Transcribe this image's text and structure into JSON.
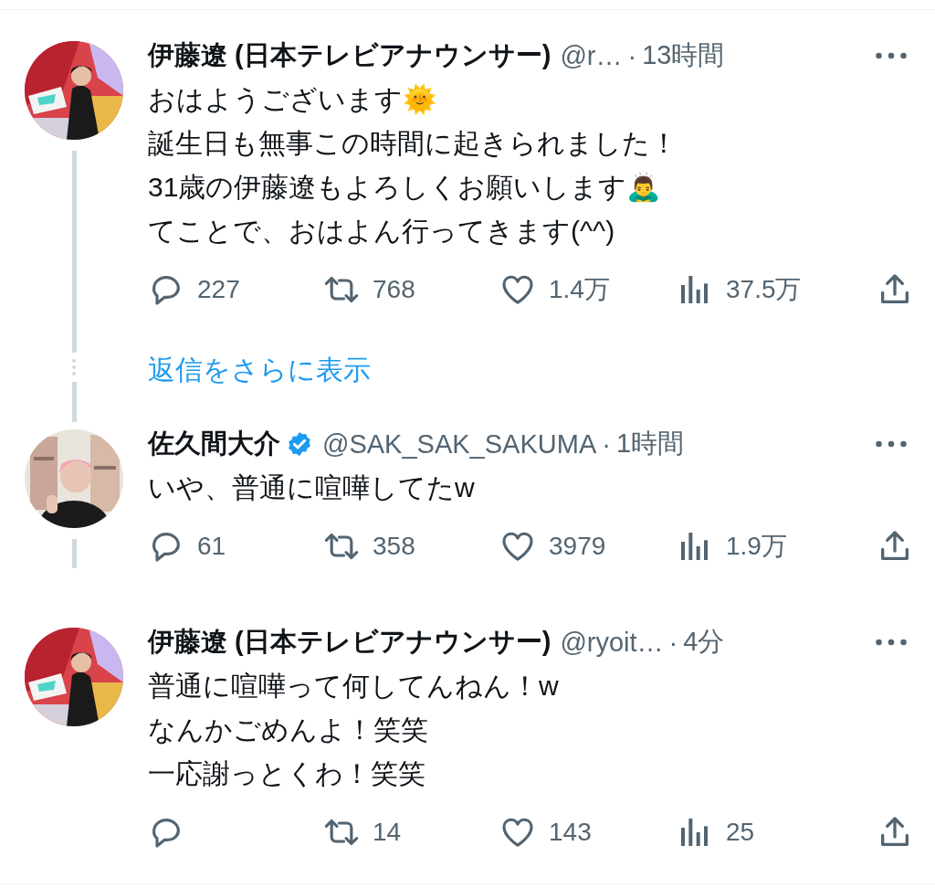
{
  "thread": [
    {
      "author_name": "伊藤遼 (日本テレビアナウンサー)",
      "verified": false,
      "handle": "@r…",
      "separator": "·",
      "time": "13時間",
      "body": [
        {
          "text": "おはようございます🌞"
        },
        {
          "text": "誕生日も無事この時間に起きられました！"
        },
        {
          "text": "31歳の伊藤遼もよろしくお願いします🙇‍♂️"
        },
        {
          "text": "てことで、おはよん行ってきます(^^)"
        }
      ],
      "stats": {
        "replies": "227",
        "retweets": "768",
        "likes": "1.4万",
        "views": "37.5万"
      },
      "thread_continues": true,
      "show_more": "返信をさらに表示"
    },
    {
      "author_name": "佐久間大介",
      "verified": true,
      "handle": "@SAK_SAK_SAKUMA",
      "separator": "·",
      "time": "1時間",
      "body": [
        {
          "text": "いや、普通に喧嘩してたw"
        }
      ],
      "stats": {
        "replies": "61",
        "retweets": "358",
        "likes": "3979",
        "views": "1.9万"
      },
      "thread_continues": true
    },
    {
      "author_name": "伊藤遼 (日本テレビアナウンサー)",
      "verified": false,
      "handle": "@ryoit…",
      "separator": "·",
      "time": "4分",
      "body": [
        {
          "text": "普通に喧嘩って何してんねん！w"
        },
        {
          "text": "なんかごめんよ！笑笑"
        },
        {
          "text": "一応謝っとくわ！笑笑"
        }
      ],
      "stats": {
        "retweets": "14",
        "likes": "143",
        "views": "25"
      },
      "thread_continues": false
    }
  ]
}
